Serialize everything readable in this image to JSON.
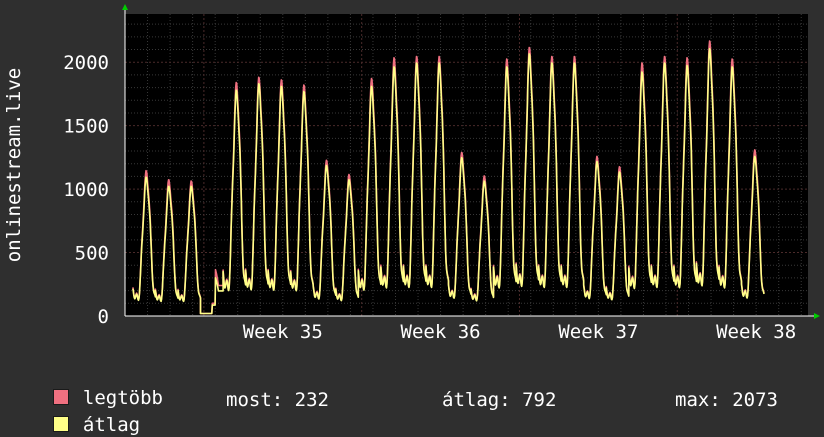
{
  "chart_data": {
    "type": "line",
    "ylabel": "onlinestream.live",
    "y_ticks": [
      0,
      500,
      1000,
      1500,
      2000
    ],
    "ylim": [
      0,
      2380
    ],
    "x_range_days": [
      0,
      30.3
    ],
    "x_ticks": [
      {
        "label": "Week 35",
        "at_day": 7.0
      },
      {
        "label": "Week 36",
        "at_day": 14.0
      },
      {
        "label": "Week 37",
        "at_day": 21.0
      },
      {
        "label": "Week 38",
        "at_day": 28.0
      }
    ],
    "grid": true,
    "colors": {
      "background": "#2f2f2f",
      "plot_background": "#000000",
      "grid_major": "#4a2a2a",
      "grid_minor": "#383838",
      "axis": "#ffffff",
      "arrow": "#00cc00",
      "series_max": "#f07080",
      "series_avg": "#ffff88"
    },
    "series": [
      {
        "name": "legtöbb",
        "color": "#f07080",
        "daily_peaks": [
          1120,
          1050,
          1040,
          400,
          1800,
          1840,
          1820,
          1780,
          1200,
          1090,
          1830,
          1990,
          2000,
          2000,
          1260,
          1080,
          1980,
          2070,
          2000,
          2000,
          1230,
          1150,
          1950,
          2000,
          1990,
          2120,
          1980,
          1280
        ]
      },
      {
        "name": "átlag",
        "color": "#ffff88",
        "daily_peaks": [
          1070,
          1000,
          1000,
          330,
          1740,
          1790,
          1770,
          1730,
          1160,
          1050,
          1770,
          1920,
          1950,
          1950,
          1220,
          1040,
          1920,
          2020,
          1950,
          1950,
          1190,
          1110,
          1880,
          1950,
          1930,
          2060,
          1920,
          1230
        ]
      }
    ],
    "legend": {
      "items": [
        {
          "label": "legtöbb",
          "color": "#f07080"
        },
        {
          "label": "átlag",
          "color": "#ffff88"
        }
      ]
    },
    "stats": {
      "most": "most: 232",
      "atlag": "átlag: 792",
      "max": "max: 2073"
    }
  }
}
